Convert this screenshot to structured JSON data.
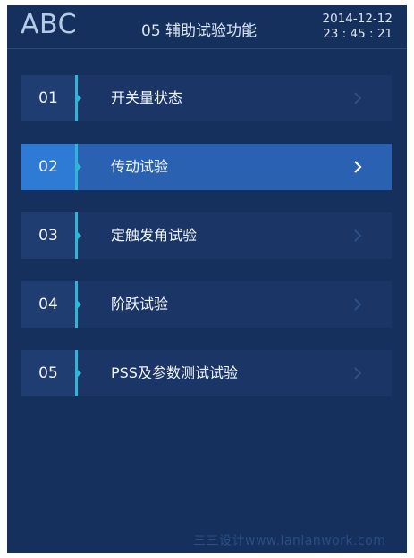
{
  "header": {
    "brand": "ABC",
    "title": "05 辅助试验功能",
    "date": "2014-12-12",
    "time": "23 : 45 : 21"
  },
  "menu": {
    "items": [
      {
        "num": "01",
        "label": "开关量状态",
        "active": false
      },
      {
        "num": "02",
        "label": "传动试验",
        "active": true
      },
      {
        "num": "03",
        "label": "定触发角试验",
        "active": false
      },
      {
        "num": "04",
        "label": "阶跃试验",
        "active": false
      },
      {
        "num": "05",
        "label": "PSS及参数测试试验",
        "active": false
      }
    ]
  },
  "colors": {
    "background": "#15305d",
    "item_background": "#1a3566",
    "number_background": "#1f3d70",
    "active_number": "#2e7bd6",
    "active_item": "#2a61b0",
    "accent": "#2fb6d6"
  },
  "watermark": "三三设计www.lanlanwork.com"
}
